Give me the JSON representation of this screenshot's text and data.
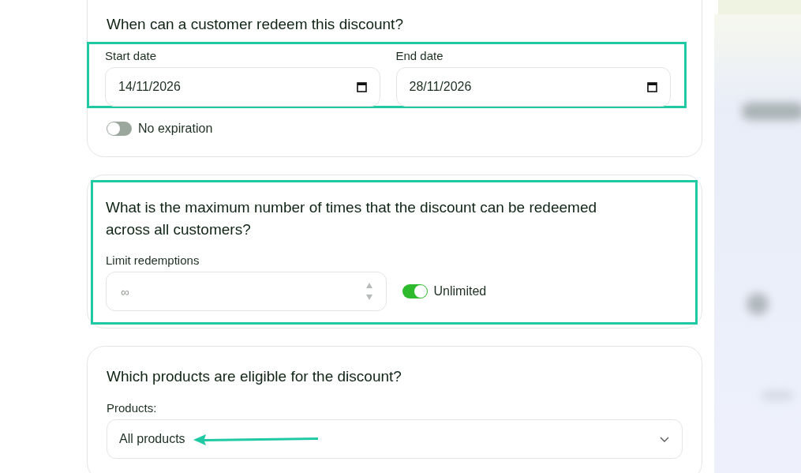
{
  "redeem_period": {
    "title": "When can a customer redeem this discount?",
    "highlighted": true,
    "start_date": {
      "label": "Start date",
      "value": "14/11/2026"
    },
    "end_date": {
      "label": "End date",
      "value": "28/11/2026"
    },
    "no_expiration": {
      "label": "No expiration",
      "on": false
    }
  },
  "max_redemptions": {
    "title": "What is the maximum number of times that the discount can be redeemed across all customers?",
    "highlighted": true,
    "limit": {
      "label": "Limit redemptions",
      "placeholder": "∞"
    },
    "unlimited": {
      "label": "Unlimited",
      "on": true
    }
  },
  "products": {
    "title": "Which products are eligible for the discount?",
    "label": "Products:",
    "value": "All products",
    "pointer": true
  }
}
